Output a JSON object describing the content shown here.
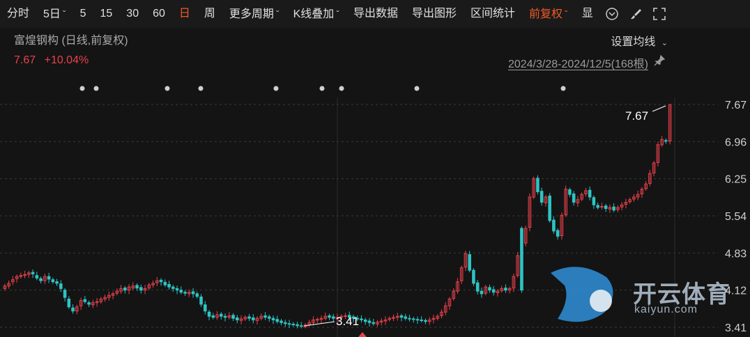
{
  "toolbar": {
    "items": [
      {
        "label": "分时",
        "chevron": false,
        "active": false
      },
      {
        "label": "5日",
        "chevron": true,
        "active": false
      },
      {
        "label": "5",
        "chevron": false,
        "active": false
      },
      {
        "label": "15",
        "chevron": false,
        "active": false
      },
      {
        "label": "30",
        "chevron": false,
        "active": false
      },
      {
        "label": "60",
        "chevron": false,
        "active": false
      },
      {
        "label": "日",
        "chevron": false,
        "active": true
      },
      {
        "label": "周",
        "chevron": false,
        "active": false
      },
      {
        "label": "更多周期",
        "chevron": true,
        "active": false
      },
      {
        "label": "K线叠加",
        "chevron": true,
        "active": false
      },
      {
        "label": "导出数据",
        "chevron": false,
        "active": false
      },
      {
        "label": "导出图形",
        "chevron": false,
        "active": false
      },
      {
        "label": "区间统计",
        "chevron": false,
        "active": false
      },
      {
        "label": "前复权",
        "chevron": true,
        "active": true
      },
      {
        "label": "显",
        "chevron": false,
        "active": false
      }
    ],
    "icons": [
      "circle-chevron-icon",
      "brush-icon",
      "fullscreen-icon"
    ]
  },
  "stock": {
    "title": "富煌钢构 (日线,前复权)",
    "price": "7.67",
    "change": "+10.04%"
  },
  "ma_setting_label": "设置均线",
  "range_label": "2024/3/28-2024/12/5(168根)",
  "colors": {
    "up": "#e8414b",
    "down": "#2ec4c4",
    "accent": "#f05a28",
    "grid": "#3a3a3a"
  },
  "watermark": {
    "text": "开云体育",
    "sub": "kaiyun.com"
  },
  "chart_data": {
    "type": "candlestick",
    "title": "富煌钢构 (日线,前复权)",
    "date_range": "2024/3/28-2024/12/5",
    "bar_count": 168,
    "y_ticks": [
      "7.67",
      "6.96",
      "6.25",
      "5.54",
      "4.83",
      "4.12",
      "3.41"
    ],
    "ylim": [
      3.41,
      7.67
    ],
    "annotations": [
      {
        "label": "7.67",
        "type": "high"
      },
      {
        "label": "3.41",
        "type": "low"
      }
    ],
    "closes": [
      4.2,
      4.25,
      4.32,
      4.38,
      4.4,
      4.42,
      4.45,
      4.43,
      4.35,
      4.3,
      4.38,
      4.33,
      4.28,
      4.25,
      4.15,
      3.98,
      3.8,
      3.72,
      3.8,
      3.92,
      3.9,
      3.85,
      3.88,
      3.9,
      3.95,
      3.98,
      4.02,
      4.05,
      4.1,
      4.15,
      4.12,
      4.18,
      4.2,
      4.16,
      4.12,
      4.15,
      4.22,
      4.25,
      4.3,
      4.28,
      4.22,
      4.18,
      4.15,
      4.12,
      4.08,
      4.06,
      4.08,
      4.05,
      4.0,
      3.85,
      3.72,
      3.62,
      3.6,
      3.65,
      3.62,
      3.6,
      3.63,
      3.58,
      3.55,
      3.57,
      3.6,
      3.58,
      3.55,
      3.58,
      3.62,
      3.6,
      3.58,
      3.55,
      3.52,
      3.5,
      3.48,
      3.47,
      3.46,
      3.44,
      3.43,
      3.45,
      3.5,
      3.55,
      3.56,
      3.58,
      3.62,
      3.6,
      3.58,
      3.6,
      3.62,
      3.63,
      3.6,
      3.58,
      3.57,
      3.55,
      3.52,
      3.5,
      3.48,
      3.51,
      3.53,
      3.55,
      3.58,
      3.6,
      3.62,
      3.6,
      3.58,
      3.57,
      3.56,
      3.55,
      3.54,
      3.52,
      3.55,
      3.58,
      3.62,
      3.7,
      3.82,
      3.95,
      4.1,
      4.28,
      4.55,
      4.82,
      4.5,
      4.25,
      4.1,
      4.05,
      4.18,
      4.12,
      4.08,
      4.1,
      4.15,
      4.12,
      4.15,
      4.38,
      4.78,
      4.12,
      5.3,
      5.9,
      6.25,
      6.0,
      5.8,
      5.9,
      5.45,
      5.25,
      5.15,
      5.55,
      6.05,
      5.95,
      5.8,
      5.85,
      5.95,
      6.02,
      5.9,
      5.75,
      5.7,
      5.72,
      5.68,
      5.7,
      5.65,
      5.7,
      5.75,
      5.8,
      5.85,
      5.9,
      5.95,
      6.05,
      6.15,
      6.35,
      6.55,
      6.9,
      7.0,
      6.97,
      7.67
    ],
    "opens": [
      4.15,
      4.2,
      4.28,
      4.34,
      4.38,
      4.4,
      4.42,
      4.46,
      4.4,
      4.34,
      4.3,
      4.38,
      4.32,
      4.28,
      4.24,
      4.12,
      3.95,
      3.78,
      3.72,
      3.82,
      3.94,
      3.88,
      3.84,
      3.88,
      3.9,
      3.95,
      3.98,
      4.02,
      4.06,
      4.1,
      4.16,
      4.12,
      4.16,
      4.21,
      4.17,
      4.12,
      4.16,
      4.22,
      4.26,
      4.31,
      4.27,
      4.23,
      4.18,
      4.15,
      4.12,
      4.08,
      4.05,
      4.09,
      4.05,
      3.99,
      3.84,
      3.7,
      3.63,
      3.6,
      3.66,
      3.62,
      3.6,
      3.64,
      3.59,
      3.54,
      3.57,
      3.61,
      3.59,
      3.54,
      3.58,
      3.63,
      3.61,
      3.58,
      3.56,
      3.53,
      3.5,
      3.48,
      3.47,
      3.46,
      3.44,
      3.42,
      3.46,
      3.5,
      3.55,
      3.56,
      3.58,
      3.63,
      3.61,
      3.57,
      3.6,
      3.62,
      3.64,
      3.61,
      3.58,
      3.57,
      3.55,
      3.53,
      3.5,
      3.47,
      3.51,
      3.53,
      3.56,
      3.58,
      3.6,
      3.63,
      3.61,
      3.58,
      3.57,
      3.56,
      3.55,
      3.54,
      3.52,
      3.56,
      3.58,
      3.63,
      3.7,
      3.82,
      3.96,
      4.1,
      4.3,
      4.56,
      4.8,
      4.5,
      4.26,
      4.1,
      4.06,
      4.17,
      4.13,
      4.07,
      4.11,
      4.16,
      4.12,
      4.16,
      4.4,
      5.3,
      5.02,
      5.32,
      5.9,
      6.26,
      6.01,
      5.79,
      5.92,
      5.46,
      5.26,
      5.16,
      5.56,
      6.04,
      5.96,
      5.79,
      5.86,
      5.96,
      6.03,
      5.89,
      5.74,
      5.71,
      5.73,
      5.67,
      5.71,
      5.66,
      5.71,
      5.76,
      5.81,
      5.86,
      5.9,
      5.96,
      6.06,
      6.16,
      6.36,
      6.56,
      6.9,
      6.98,
      6.97
    ]
  }
}
